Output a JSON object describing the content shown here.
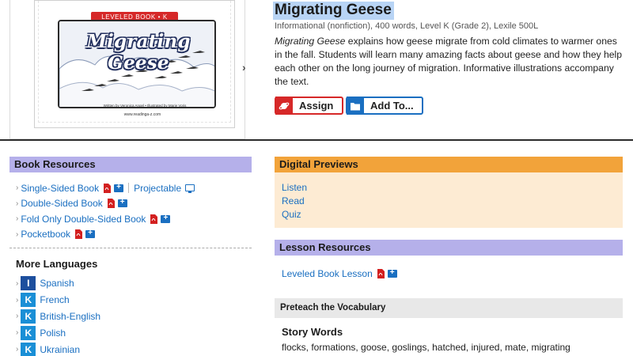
{
  "cover": {
    "banner": "LEVELED BOOK • K",
    "title": "Migrating Geese",
    "credits": "Written by Veronica Angel  •  Illustrated by Marie Voris",
    "url": "www.readinga-z.com"
  },
  "book": {
    "title": "Migrating Geese",
    "meta": "Informational (nonfiction), 400 words, Level K (Grade 2), Lexile 500L",
    "desc_title": "Migrating Geese",
    "desc_rest": " explains how geese migrate from cold climates to warmer ones in the fall. Students will learn many amazing facts about geese and how they help each other on the long journey of migration. Informative illustrations accompany the text."
  },
  "actions": {
    "assign": "Assign",
    "add_to": "Add To..."
  },
  "book_resources": {
    "heading": "Book Resources",
    "items": [
      {
        "label": "Single-Sided Book"
      },
      {
        "label": "Double-Sided Book"
      },
      {
        "label": "Fold Only Double-Sided Book"
      },
      {
        "label": "Pocketbook"
      }
    ],
    "projectable": "Projectable"
  },
  "more_languages": {
    "heading": "More Languages",
    "items": [
      {
        "level": "I",
        "label": "Spanish"
      },
      {
        "level": "K",
        "label": "French"
      },
      {
        "level": "K",
        "label": "British-English"
      },
      {
        "level": "K",
        "label": "Polish"
      },
      {
        "level": "K",
        "label": "Ukrainian"
      }
    ]
  },
  "digital_previews": {
    "heading": "Digital Previews",
    "items": [
      "Listen",
      "Read",
      "Quiz"
    ]
  },
  "lesson_resources": {
    "heading": "Lesson Resources",
    "item": "Leveled Book Lesson"
  },
  "preteach": {
    "heading": "Preteach the Vocabulary",
    "story_heading": "Story Words",
    "story_words": "flocks, formations, goose, goslings, hatched, injured, mate, migrating"
  },
  "colors": {
    "accent_blue": "#1a6fc1",
    "assign_red": "#d62828",
    "lavender": "#b5b0ea",
    "orange": "#f2a33a",
    "peach": "#fdebd3"
  },
  "icons": {
    "pdf": "pdf-icon",
    "folder_add": "folder-add-icon",
    "projector": "projector-icon",
    "assign": "planet-icon",
    "add_to": "folder-icon",
    "next": "chevron-right-icon"
  }
}
